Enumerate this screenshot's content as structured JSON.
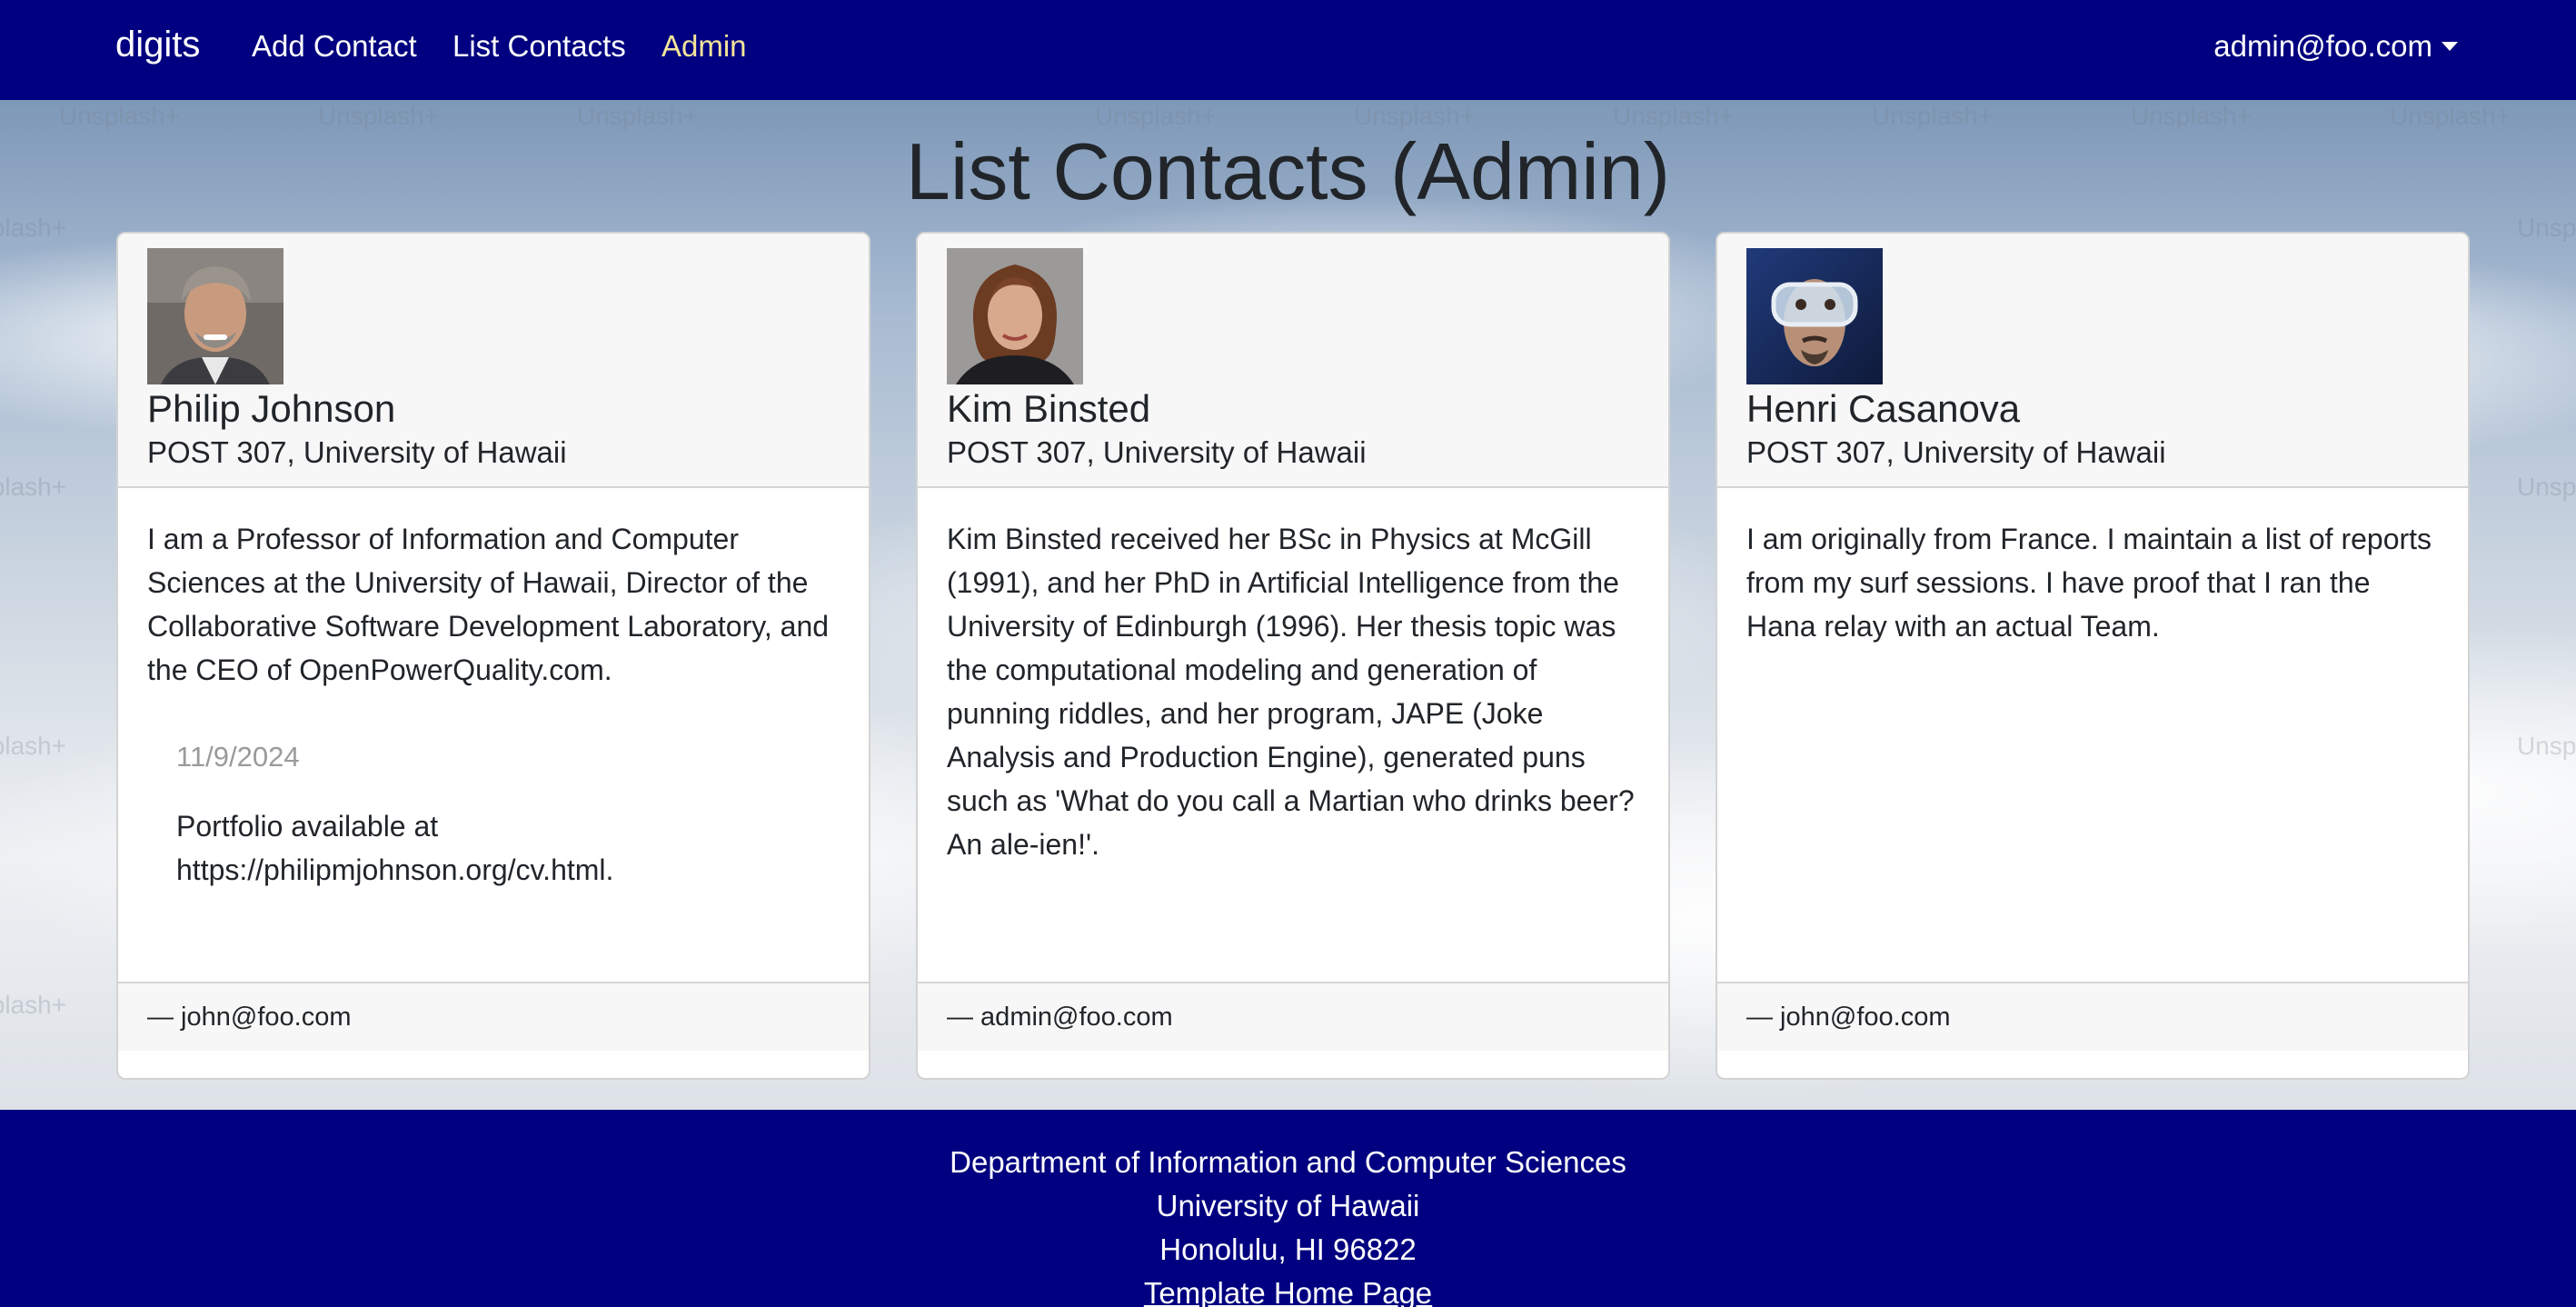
{
  "navbar": {
    "brand": "digits",
    "links": [
      {
        "label": "Add Contact"
      },
      {
        "label": "List Contacts"
      },
      {
        "label": "Admin"
      }
    ],
    "user": "admin@foo.com"
  },
  "page_title": "List Contacts (Admin)",
  "background_watermark": "Unsplash+",
  "contacts": [
    {
      "name": "Philip Johnson",
      "address": "POST 307, University of Hawaii",
      "description": "I am a Professor of Information and Computer Sciences at the University of Hawaii, Director of the Collaborative Software Development Laboratory, and the CEO of OpenPowerQuality.com.",
      "note_date": "11/9/2024",
      "note_text": "Portfolio available at https://philipmjohnson.org/cv.html.",
      "owner": "— john@foo.com"
    },
    {
      "name": "Kim Binsted",
      "address": "POST 307, University of Hawaii",
      "description": "Kim Binsted received her BSc in Physics at McGill (1991), and her PhD in Artificial Intelligence from the University of Edinburgh (1996). Her thesis topic was the computational modeling and generation of punning riddles, and her program, JAPE (Joke Analysis and Production Engine), generated puns such as 'What do you call a Martian who drinks beer? An ale-ien!'.",
      "owner": "— admin@foo.com"
    },
    {
      "name": "Henri Casanova",
      "address": "POST 307, University of Hawaii",
      "description": "I am originally from France. I maintain a list of reports from my surf sessions. I have proof that I ran the Hana relay with an actual Team.",
      "owner": "— john@foo.com"
    }
  ],
  "footer": {
    "line1": "Department of Information and Computer Sciences",
    "line2": "University of Hawaii",
    "line3": "Honolulu, HI 96822",
    "link": "Template Home Page"
  },
  "colors": {
    "navbar": "#000080",
    "active_link": "#f3e39a",
    "card_header": "#f7f7f7"
  }
}
